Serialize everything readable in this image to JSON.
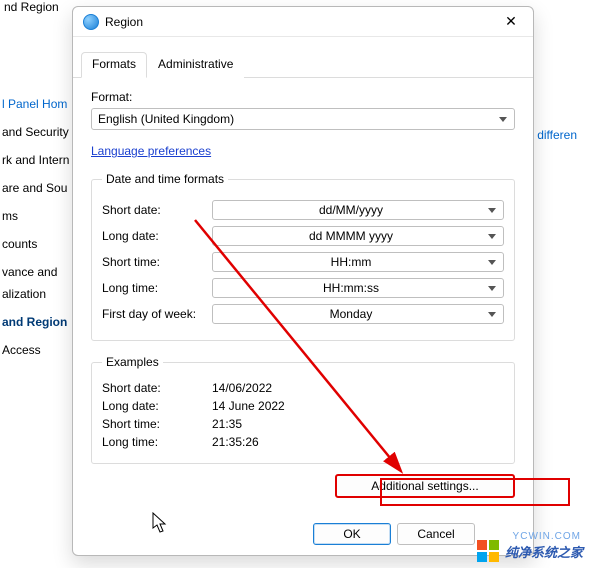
{
  "background": {
    "header": "nd Region",
    "right_link": "differen",
    "items": [
      {
        "label": "l Panel Hom",
        "class": "blue"
      },
      {
        "label": "and Security"
      },
      {
        "label": "rk and Intern"
      },
      {
        "label": "are and Sou"
      },
      {
        "label": "ms"
      },
      {
        "label": "counts"
      },
      {
        "label": "vance and"
      },
      {
        "label": "alization"
      },
      {
        "label": "and Region",
        "class": "bold"
      },
      {
        "label": "Access"
      }
    ]
  },
  "dialog": {
    "title": "Region",
    "tabs": {
      "formats": "Formats",
      "administrative": "Administrative"
    },
    "format_label": "Format:",
    "format_value": "English (United Kingdom)",
    "lang_pref": "Language preferences",
    "group1_legend": "Date and time formats",
    "short_date_label": "Short date:",
    "short_date_value": "dd/MM/yyyy",
    "long_date_label": "Long date:",
    "long_date_value": "dd MMMM yyyy",
    "short_time_label": "Short time:",
    "short_time_value": "HH:mm",
    "long_time_label": "Long time:",
    "long_time_value": "HH:mm:ss",
    "first_day_label": "First day of week:",
    "first_day_value": "Monday",
    "group2_legend": "Examples",
    "ex_short_date_label": "Short date:",
    "ex_short_date_value": "14/06/2022",
    "ex_long_date_label": "Long date:",
    "ex_long_date_value": "14 June 2022",
    "ex_short_time_label": "Short time:",
    "ex_short_time_value": "21:35",
    "ex_long_time_label": "Long time:",
    "ex_long_time_value": "21:35:26",
    "additional_settings": "Additional settings...",
    "ok": "OK",
    "cancel": "Cancel"
  },
  "watermark": {
    "text": "纯净系统之家",
    "url": "YCWIN.COM"
  }
}
